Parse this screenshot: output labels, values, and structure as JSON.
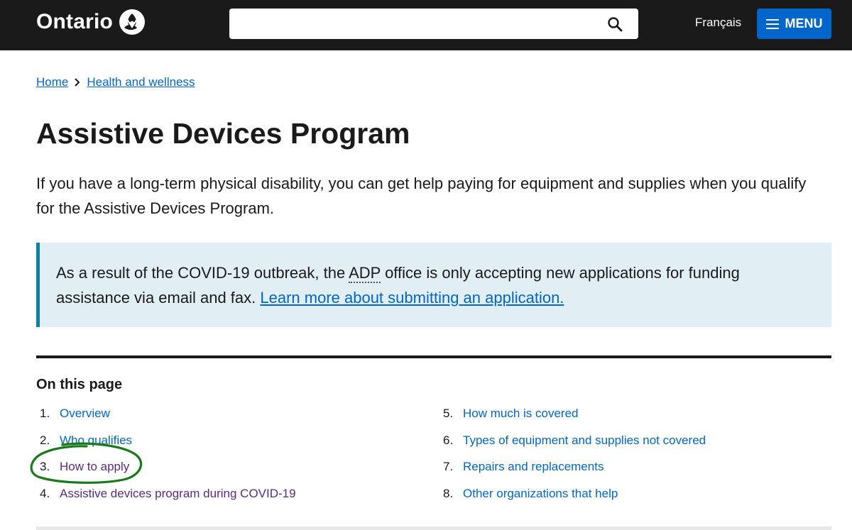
{
  "header": {
    "logo_text": "Ontario",
    "search": {
      "value": "",
      "placeholder": ""
    },
    "language_label": "Français",
    "menu_label": "MENU"
  },
  "breadcrumb": [
    "Home",
    "Health and wellness"
  ],
  "page": {
    "title": "Assistive Devices Program",
    "lead": "If you have a long-term physical disability, you can get help paying for equipment and supplies when you qualify for the Assistive Devices Program."
  },
  "callout": {
    "text_before": "As a result of the COVID-19 outbreak, the ",
    "abbr": "ADP",
    "text_after": " office is only accepting new applications for funding assistance via email and fax. ",
    "link": "Learn more about submitting an application."
  },
  "on_this_page": {
    "heading": "On this page",
    "items": [
      {
        "num": "1.",
        "label": "Overview",
        "visited": false
      },
      {
        "num": "2.",
        "label": "Who qualifies",
        "visited": false
      },
      {
        "num": "3.",
        "label": "How to apply",
        "visited": true
      },
      {
        "num": "4.",
        "label": "Assistive devices program during COVID-19",
        "visited": true
      },
      {
        "num": "5.",
        "label": "How much is covered",
        "visited": false
      },
      {
        "num": "6.",
        "label": "Types of equipment and supplies not covered",
        "visited": false
      },
      {
        "num": "7.",
        "label": "Repairs and replacements",
        "visited": false
      },
      {
        "num": "8.",
        "label": "Other organizations that help",
        "visited": false
      }
    ]
  },
  "colors": {
    "header_bg": "#1a1a1a",
    "link": "#0066cc",
    "visited_link": "#5a2a82",
    "menu_button": "#0066cc",
    "callout_bg": "#e1eef3",
    "callout_border": "#1080a6",
    "annotation": "#1a7a1a"
  },
  "annotation": {
    "shape": "hand-drawn-circle",
    "target": "How to apply"
  }
}
